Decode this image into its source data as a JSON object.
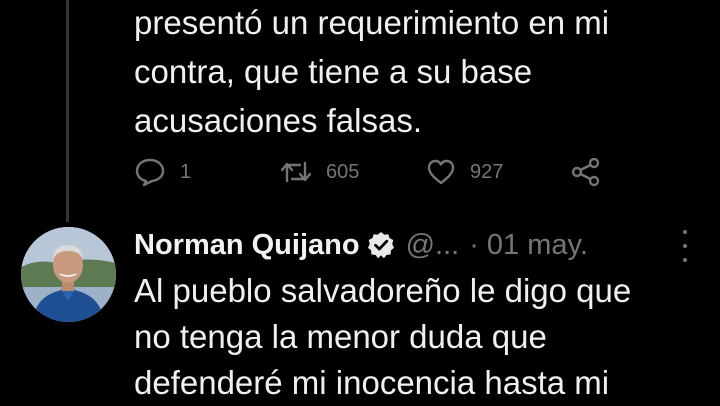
{
  "previous_tweet": {
    "text_lines": [
      "presentó un requerimiento en mi",
      "contra, que tiene a su base",
      "acusaciones falsas."
    ],
    "actions": {
      "reply_icon": "reply-icon",
      "reply_count": "1",
      "retweet_icon": "retweet-icon",
      "retweet_count": "605",
      "like_icon": "heart-icon",
      "like_count": "927",
      "share_icon": "share-icon"
    }
  },
  "tweet": {
    "author_name": "Norman Quijano",
    "verified_icon": "verified-badge-icon",
    "handle": "@...",
    "separator": "·",
    "date": "01 may.",
    "more_icon": "more-options-icon",
    "text_lines": [
      "Al pueblo salvadoreño le digo que",
      "no tenga la menor duda que",
      "defenderé mi inocencia hasta mi"
    ]
  },
  "colors": {
    "background": "#000000",
    "text": "#e7e9ea",
    "muted": "#71767b",
    "thread_line": "#333639"
  }
}
